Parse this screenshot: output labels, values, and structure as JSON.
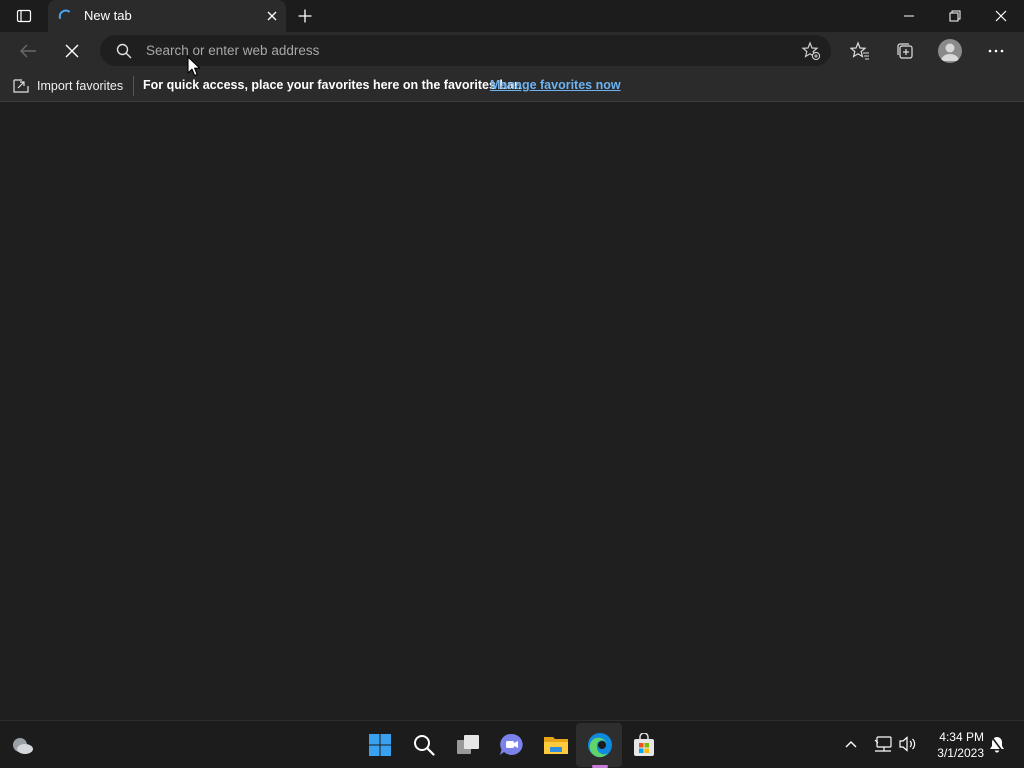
{
  "tabs": [
    {
      "title": "New tab",
      "loading": true
    }
  ],
  "address_bar": {
    "placeholder": "Search or enter web address",
    "value": ""
  },
  "favorites_bar": {
    "import_label": "Import favorites",
    "message": "For quick access, place your favorites here on the favorites bar.",
    "link_label": "Manage favorites now"
  },
  "taskbar": {
    "apps": [
      "windows-start-icon",
      "search-icon",
      "task-view-icon",
      "teams-chat-icon",
      "file-explorer-icon",
      "edge-icon",
      "microsoft-store-icon"
    ],
    "active_app": "edge-icon",
    "clock": {
      "time": "4:34 PM",
      "date": "3/1/2023"
    }
  },
  "colors": {
    "accent_link": "#6db3f2",
    "active_indicator": "#c879d8",
    "edge_blue": "#0f8ae0",
    "edge_green": "#5fd46a"
  }
}
